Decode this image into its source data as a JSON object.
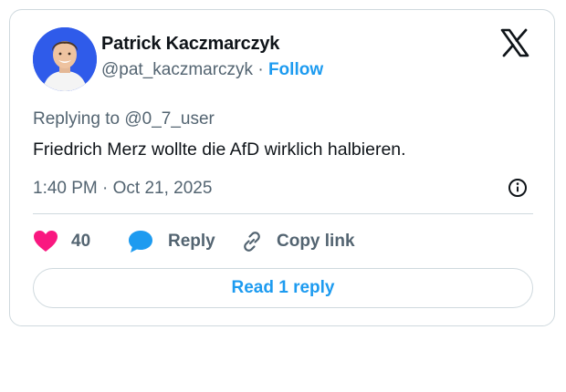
{
  "author": {
    "name": "Patrick Kaczmarczyk",
    "handle": "@pat_kaczmarczyk",
    "separator": "·",
    "follow_label": "Follow"
  },
  "tweet": {
    "replying_prefix": "Replying to",
    "replying_to": "@0_7_user",
    "text": "Friedrich Merz wollte die AfD wirklich halbieren.",
    "timestamp": "1:40 PM · Oct 21, 2025"
  },
  "actions": {
    "like_count": "40",
    "reply_label": "Reply",
    "copy_label": "Copy link"
  },
  "read_replies_label": "Read 1 reply",
  "icons": {
    "logo": "x-logo-icon",
    "info": "info-icon",
    "like": "heart-icon",
    "reply": "speech-bubble-icon",
    "copy": "link-icon"
  },
  "colors": {
    "accent": "#1d9bf0",
    "heart": "#f91880",
    "secondary_text": "#536471",
    "border": "#cfd9de"
  }
}
